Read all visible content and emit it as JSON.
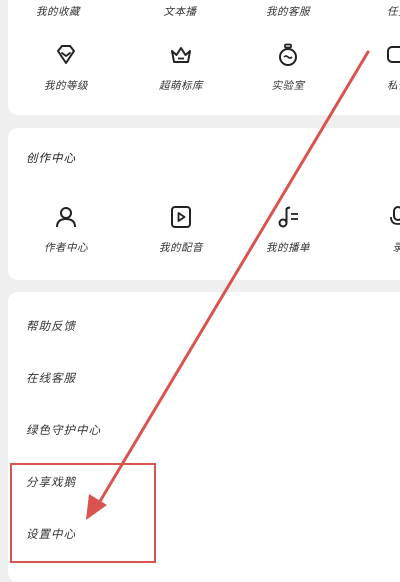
{
  "top_row_labels": [
    "我的收藏",
    "文本播",
    "我的客服",
    "任务"
  ],
  "top_grid": [
    {
      "label": "我的等级",
      "icon": "gem-icon"
    },
    {
      "label": "超萌标库",
      "icon": "crown-icon"
    },
    {
      "label": "实验室",
      "icon": "flask-icon"
    },
    {
      "label": "私信",
      "icon": "message-icon"
    }
  ],
  "creation": {
    "title": "创作中心",
    "items": [
      {
        "label": "作者中心",
        "icon": "person-icon"
      },
      {
        "label": "我的配音",
        "icon": "play-icon"
      },
      {
        "label": "我的播单",
        "icon": "music-list-icon"
      },
      {
        "label": "录",
        "icon": "mic-icon"
      }
    ]
  },
  "service": {
    "items": [
      {
        "label": "帮助反馈"
      },
      {
        "label": "在线客服"
      },
      {
        "label": "绿色守护中心"
      },
      {
        "label": "分享戏鹅"
      },
      {
        "label": "设置中心"
      }
    ]
  },
  "colors": {
    "annotation": "#d9534f",
    "background": "#efefef",
    "card": "#ffffff"
  }
}
